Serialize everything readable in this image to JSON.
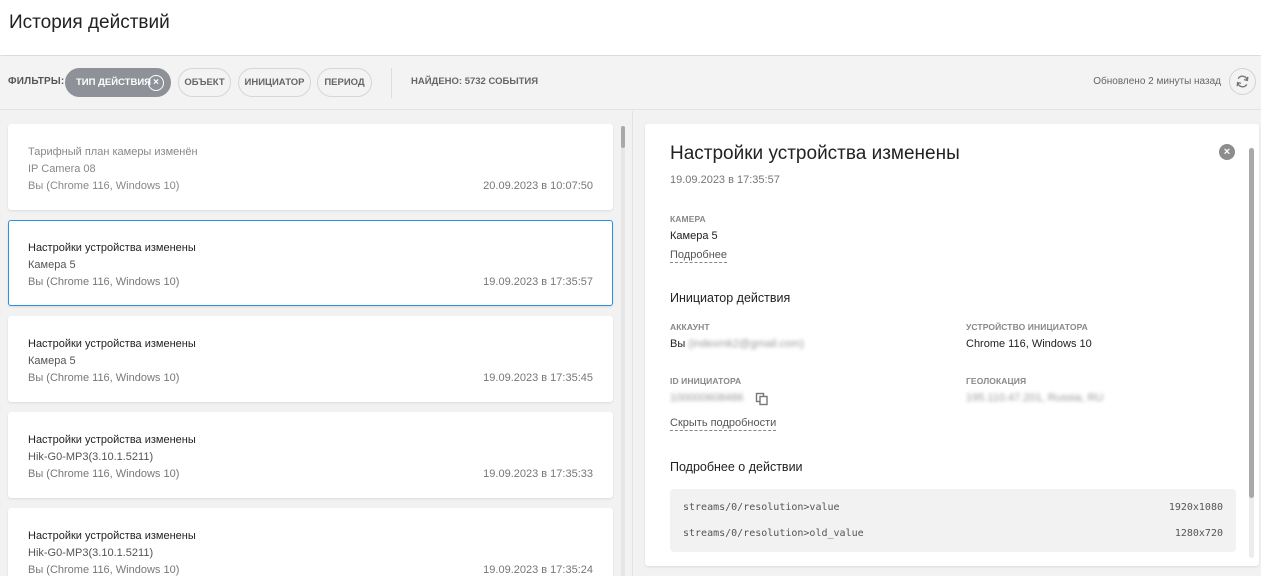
{
  "page": {
    "title": "История действий"
  },
  "filters": {
    "label": "ФИЛЬТРЫ:",
    "chips": [
      {
        "label": "ТИП ДЕЙСТВИЯ",
        "active": true
      },
      {
        "label": "ОБЪЕКТ",
        "active": false
      },
      {
        "label": "ИНИЦИАТОР",
        "active": false
      },
      {
        "label": "ПЕРИОД",
        "active": false
      }
    ],
    "found": "НАЙДЕНО: 5732 СОБЫТИЯ",
    "updated": "Обновлено 2 минуты назад"
  },
  "events": [
    {
      "title": "Тарифный план камеры изменён",
      "object": "IP Camera 08",
      "initiator": "Вы (Chrome 116, Windows 10)",
      "date": "20.09.2023 в 10:07:50"
    },
    {
      "title": "Настройки устройства изменены",
      "object": "Камера 5",
      "initiator": "Вы (Chrome 116, Windows 10)",
      "date": "19.09.2023 в 17:35:57"
    },
    {
      "title": "Настройки устройства изменены",
      "object": "Камера 5",
      "initiator": "Вы (Chrome 116, Windows 10)",
      "date": "19.09.2023 в 17:35:45"
    },
    {
      "title": "Настройки устройства изменены",
      "object": "Hik-G0-MP3(3.10.1.5211)",
      "initiator": "Вы (Chrome 116, Windows 10)",
      "date": "19.09.2023 в 17:35:33"
    },
    {
      "title": "Настройки устройства изменены",
      "object": "Hik-G0-MP3(3.10.1.5211)",
      "initiator": "Вы (Chrome 116, Windows 10)",
      "date": "19.09.2023 в 17:35:24"
    }
  ],
  "detail": {
    "title": "Настройки устройства изменены",
    "timestamp": "19.09.2023 в 17:35:57",
    "camera_label": "КАМЕРА",
    "camera_value": "Камера 5",
    "more_link": "Подробнее",
    "initiator_heading": "Инициатор действия",
    "account_label": "АККАУНТ",
    "account_prefix": "Вы",
    "account_blurred": "(indexmk2@gmail.com)",
    "device_label": "УСТРОЙСТВО ИНИЦИАТОРА",
    "device_value": "Chrome 116, Windows 10",
    "id_label": "ID ИНИЦИАТОРА",
    "id_blurred": "100000608486",
    "geo_label": "ГЕОЛОКАЦИЯ",
    "geo_blurred": "195.110.47.201, Russia, RU",
    "hide_link": "Скрыть подробности",
    "action_heading": "Подробнее о действии",
    "changes": [
      {
        "key": "streams/0/resolution>value",
        "value": "1920x1080"
      },
      {
        "key": "streams/0/resolution>old_value",
        "value": "1280x720"
      }
    ]
  }
}
